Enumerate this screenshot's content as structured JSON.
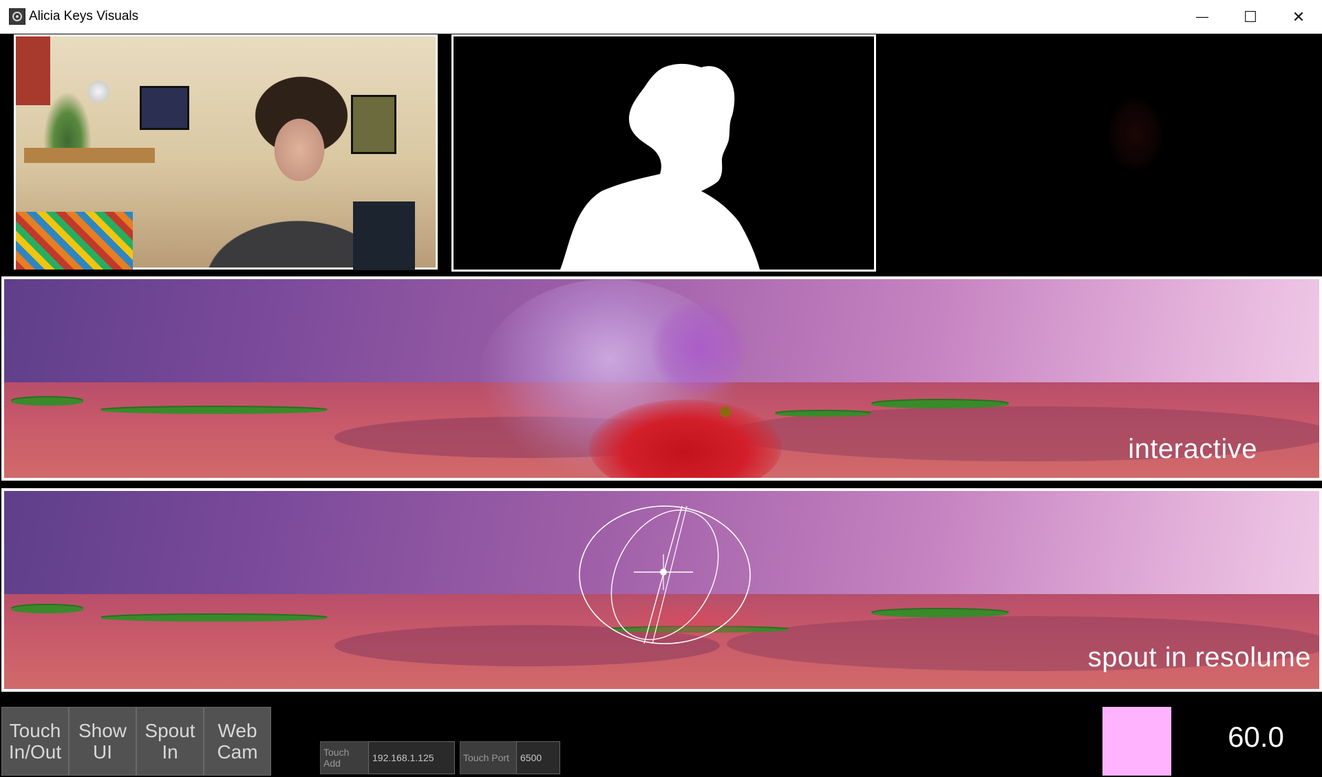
{
  "window": {
    "title": "Alicia Keys Visuals",
    "minimize_glyph": "—",
    "maximize_glyph": "☐",
    "close_glyph": "✕"
  },
  "panels": {
    "webcam": "webcam feed",
    "mask": "person segmentation mask",
    "right": "empty output"
  },
  "scenes": {
    "interactive_label": "interactive",
    "spout_label": "spout in resolume"
  },
  "controls": {
    "buttons": [
      {
        "line1": "Touch",
        "line2": "In/Out"
      },
      {
        "line1": "Show",
        "line2": "UI"
      },
      {
        "line1": "Spout",
        "line2": "In"
      },
      {
        "line1": "Web",
        "line2": "Cam"
      }
    ],
    "touch_address_label": "Touch Add",
    "touch_address_value": "192.168.1.125",
    "touch_port_label": "Touch Port",
    "touch_port_value": "6500",
    "color_swatch": "#ffb3ff",
    "fps": "60.0"
  },
  "colors": {
    "titlebar": "#ffffff",
    "background": "#000000",
    "button_bg": "#525252",
    "sky_start": "#5f3f8a",
    "sky_end": "#f0cae6",
    "ground": "#c95a6a"
  }
}
